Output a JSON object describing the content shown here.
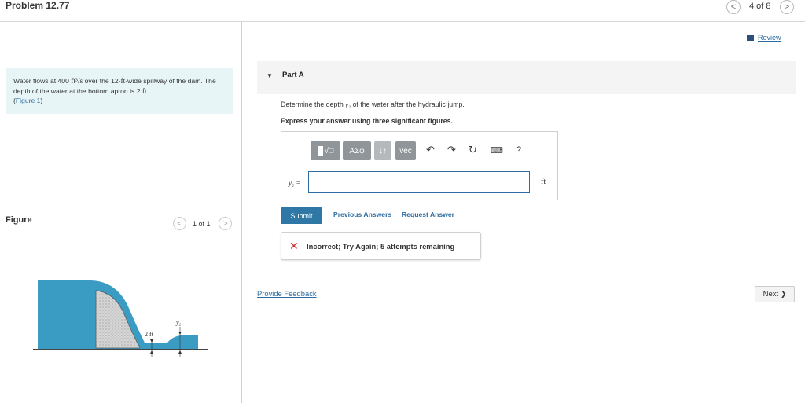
{
  "header": {
    "title": "Problem 12.77",
    "counter": "4 of 8",
    "prev_glyph": "<",
    "next_glyph": ">"
  },
  "statement": {
    "part1": "Water flows at 400 ",
    "flow_units": "ft³/s",
    "part2": " over the 12-",
    "width_unit": "ft",
    "part3": "-wide spillway of the dam. The depth of the water at the bottom apron is 2 ",
    "depth_unit": "ft",
    "part4": ".",
    "figure_link_open": "(",
    "figure_link": "Figure 1",
    "figure_link_close": ")"
  },
  "figure": {
    "label": "Figure",
    "count": "1 of 1",
    "dim_depth": "2 ft",
    "dim_y2": "y₂"
  },
  "review": {
    "label": "Review"
  },
  "part": {
    "label": "Part A"
  },
  "question": {
    "text_a": "Determine the depth ",
    "var": "y₂",
    "text_b": " of the water after the hydraulic jump.",
    "instruction": "Express your answer using three significant figures."
  },
  "answer": {
    "label": "y₂ =",
    "value": "",
    "unit": "ft",
    "toolbar": {
      "templates": "√□",
      "greek": "ΑΣφ",
      "arrows": "↓↑",
      "vec": "vec",
      "help": "?"
    }
  },
  "actions": {
    "submit": "Submit",
    "previous_answers": "Previous Answers",
    "request_answer": "Request Answer"
  },
  "feedback": {
    "icon": "✕",
    "message": "Incorrect; Try Again; 5 attempts remaining"
  },
  "footer": {
    "provide_feedback": "Provide Feedback",
    "next": "Next",
    "next_glyph": "❯"
  },
  "colors": {
    "accent": "#2f78a6",
    "link": "#2d6ca2",
    "error": "#c8322b",
    "statement_bg": "#e8f5f7",
    "water": "#3a9cc2"
  }
}
